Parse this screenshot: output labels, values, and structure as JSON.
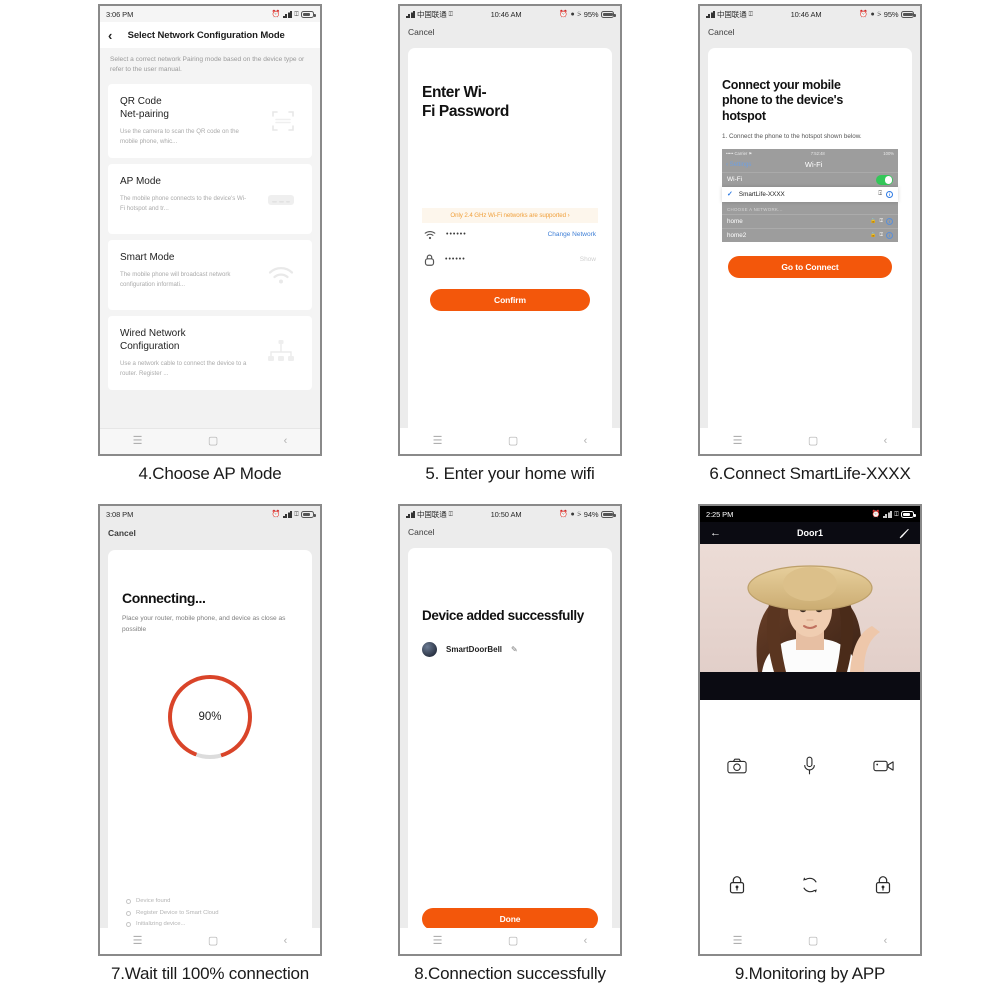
{
  "meta": {
    "background": "#ffffff",
    "accent_orange": "#f3570b",
    "progress_red": "#d94429"
  },
  "steps": [
    {
      "id": "step4",
      "caption": "4.Choose AP Mode",
      "statusbar": {
        "time": "3:06 PM",
        "icons": [
          "alarm-icon",
          "signal-icon",
          "wifi-icon",
          "battery-icon"
        ]
      },
      "header": {
        "back": "‹",
        "title": "Select Network Configuration Mode"
      },
      "subtitle": "Select a correct network Pairing mode based on the device type or refer to the user manual.",
      "cards": [
        {
          "title": "QR Code\nNet-pairing",
          "title_l1": "QR Code",
          "title_l2": "Net-pairing",
          "desc": "Use the camera to scan the QR code on the mobile phone, whic...",
          "icon": "qr-scan-icon"
        },
        {
          "title_l1": "AP Mode",
          "title_l2": "",
          "desc": "The mobile phone connects to the device's Wi-Fi hotspot and tr...",
          "icon": "router-icon"
        },
        {
          "title_l1": "Smart Mode",
          "title_l2": "",
          "desc": "The mobile phone will broadcast network configuration informati...",
          "icon": "wifi-signal-icon"
        },
        {
          "title_l1": "Wired Network",
          "title_l2": "Configuration",
          "desc": "Use a network cable to connect the device to a router. Register ...",
          "icon": "wired-network-icon"
        }
      ],
      "navbar": [
        "menu-icon",
        "home-icon",
        "back-icon"
      ]
    },
    {
      "id": "step5",
      "caption": "5. Enter your home wifi",
      "statusbar": {
        "carrier": "中国联通",
        "time": "10:46 AM",
        "battery": "95%"
      },
      "cancel": "Cancel",
      "title_l1": "Enter Wi-",
      "title_l2": "Fi Password",
      "note": "Only 2.4 GHz Wi-Fi networks are supported ›",
      "ssid_field": {
        "icon": "wifi-icon",
        "value": "••••••",
        "action": "Change Network"
      },
      "password_field": {
        "icon": "lock-icon",
        "value": "••••••",
        "action": "Show"
      },
      "button": "Confirm",
      "navbar": [
        "menu-icon",
        "home-icon",
        "back-icon"
      ]
    },
    {
      "id": "step6",
      "caption": "6.Connect SmartLife-XXXX",
      "statusbar": {
        "carrier": "中国联通",
        "time": "10:46 AM",
        "battery": "95%"
      },
      "cancel": "Cancel",
      "title_l1": "Connect your mobile",
      "title_l2": "phone to the device's",
      "title_l3": "hotspot",
      "instruction": "1. Connect the phone to the hotspot shown below.",
      "wifi_mock": {
        "carrier": "••••• Carrier ⚑",
        "time": "7:52:48",
        "battery": "100%",
        "back": "‹ Settings",
        "title": "Wi-Fi",
        "toggle_row": "Wi-Fi",
        "toggle_on": true,
        "selected_network": "SmartLife-XXXX",
        "section_header": "CHOOSE A NETWORK...",
        "networks": [
          "home",
          "home2"
        ]
      },
      "button": "Go to Connect",
      "navbar": [
        "menu-icon",
        "home-icon",
        "back-icon"
      ]
    },
    {
      "id": "step7",
      "caption": "7.Wait till 100% connection",
      "statusbar": {
        "time": "3:08 PM"
      },
      "cancel": "Cancel",
      "title": "Connecting...",
      "subtitle": "Place your router, mobile phone, and device as close as possible",
      "progress": "90%",
      "progress_value": 90,
      "logs": [
        "Device found",
        "Register Device to Smart Cloud",
        "Initializing device..."
      ],
      "navbar": [
        "menu-icon",
        "home-icon",
        "back-icon"
      ]
    },
    {
      "id": "step8",
      "caption": "8.Connection successfully",
      "statusbar": {
        "carrier": "中国联通",
        "time": "10:50 AM",
        "battery": "94%"
      },
      "cancel": "Cancel",
      "title": "Device added successfully",
      "device_name": "SmartDoorBell",
      "edit_icon": "pencil-icon",
      "button": "Done",
      "navbar": [
        "menu-icon",
        "home-icon",
        "back-icon"
      ]
    },
    {
      "id": "step9",
      "caption": "9.Monitoring by APP",
      "statusbar": {
        "time": "2:25 PM"
      },
      "header": {
        "back": "←",
        "title": "Door1",
        "edit": "pencil-icon"
      },
      "video_alt": "live-video-woman-in-straw-hat",
      "controls": [
        {
          "name": "snapshot-button",
          "icon": "camera-icon"
        },
        {
          "name": "mic-button",
          "icon": "microphone-icon"
        },
        {
          "name": "record-button",
          "icon": "video-camera-icon"
        },
        {
          "name": "lock-left-button",
          "icon": "lock-icon"
        },
        {
          "name": "refresh-button",
          "icon": "refresh-icon"
        },
        {
          "name": "lock-right-button",
          "icon": "lock-icon"
        }
      ],
      "navbar": [
        "menu-icon",
        "home-icon",
        "back-icon"
      ]
    }
  ]
}
